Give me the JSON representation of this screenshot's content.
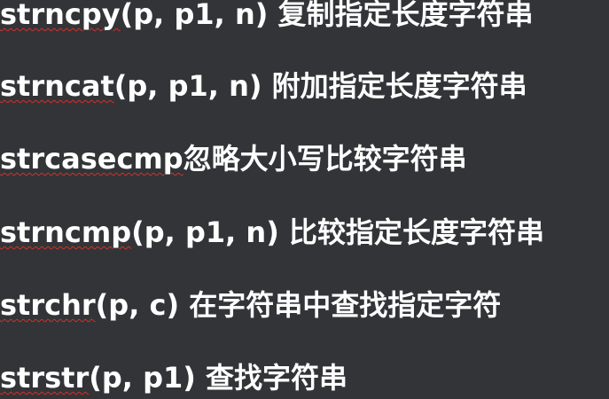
{
  "lines": [
    {
      "fn": "strncpy",
      "rest": "(p, p1, n) 复制指定长度字符串"
    },
    {
      "fn": "strncat",
      "rest": "(p, p1, n) 附加指定长度字符串"
    },
    {
      "fn": "strcasecmp",
      "rest": "忽略大小写比较字符串"
    },
    {
      "fn": "strncmp",
      "rest": "(p, p1, n) 比较指定长度字符串"
    },
    {
      "fn": "strchr",
      "rest": "(p, c) 在字符串中查找指定字符"
    },
    {
      "fn": "strstr",
      "rest": "(p, p1) 查找字符串"
    }
  ],
  "colors": {
    "background": "#333437",
    "text": "#ffffff",
    "spellcheck_underline": "#d0312d"
  }
}
